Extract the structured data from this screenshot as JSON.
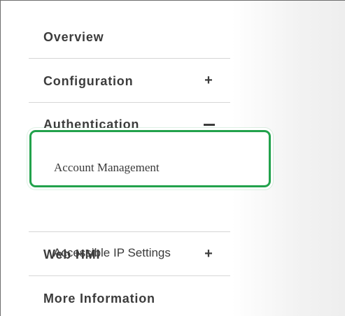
{
  "menu": {
    "overview": "Overview",
    "configuration": "Configuration",
    "configuration_toggle": "+",
    "authentication": "Authentication",
    "authentication_toggle": "−",
    "account_management": "Account Management",
    "accessible_ip_settings": "Accessible IP Settings",
    "web_hmi": "Web HMI",
    "web_hmi_toggle": "+",
    "more_information": "More Information"
  },
  "colors": {
    "highlight_border": "#22a24c",
    "text": "#3c3c3c",
    "divider": "#d6d6d6"
  }
}
